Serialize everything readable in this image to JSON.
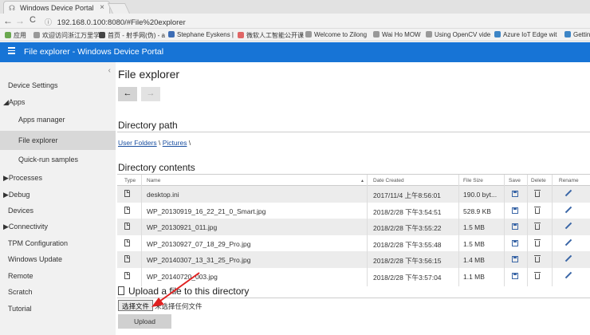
{
  "browser": {
    "tab_title": "Windows Device Portal",
    "tab_close": "×",
    "back": "←",
    "forward": "→",
    "reload": "C",
    "url": "192.168.0.100:8080/#File%20explorer",
    "bookmarks": [
      {
        "label": "应用",
        "color": "#6aa84f"
      },
      {
        "label": "欢迎访问浙江万里学",
        "color": "#999999"
      },
      {
        "label": "首页 - 射手网(伪) - a",
        "color": "#444444"
      },
      {
        "label": "Stephane Eyskens |",
        "color": "#3d6db5"
      },
      {
        "label": "微软人工智能公开课",
        "color": "#e06666"
      },
      {
        "label": "Welcome to Zilong",
        "color": "#999999"
      },
      {
        "label": "Wai Ho MOW",
        "color": "#999999"
      },
      {
        "label": "Using OpenCV vide",
        "color": "#999999"
      },
      {
        "label": "Azure IoT Edge wit",
        "color": "#3d85c6"
      },
      {
        "label": "Getting",
        "color": "#3d85c6"
      }
    ]
  },
  "header": {
    "title": "File explorer - Windows Device Portal"
  },
  "sidebar": {
    "collapse": "‹",
    "items": [
      {
        "label": "Device Settings"
      },
      {
        "label": "◢Apps"
      },
      {
        "label": "Apps manager"
      },
      {
        "label": "File explorer"
      },
      {
        "label": "Quick-run samples"
      },
      {
        "label": "▶Processes"
      },
      {
        "label": "▶Debug"
      },
      {
        "label": "Devices"
      },
      {
        "label": "▶Connectivity"
      },
      {
        "label": "TPM Configuration"
      },
      {
        "label": "Windows Update"
      },
      {
        "label": "Remote"
      },
      {
        "label": "Scratch"
      },
      {
        "label": "Tutorial"
      }
    ]
  },
  "main": {
    "title": "File explorer",
    "nav_back": "←",
    "nav_forward": "→",
    "path_heading": "Directory path",
    "crumbs": {
      "folder1": "User Folders",
      "sep1": " \\ ",
      "folder2": "Pictures",
      "sep2": " \\"
    },
    "contents_heading": "Directory contents",
    "columns": {
      "type": "Type",
      "name": "Name",
      "sort_marker": "▲",
      "date": "Date Created",
      "size": "File Size",
      "save": "Save",
      "delete": "Delete",
      "rename": "Rename"
    },
    "files": [
      {
        "name": "desktop.ini",
        "date": "2017/11/4 上午8:56:01",
        "size": "190.0 byt..."
      },
      {
        "name": "WP_20130919_16_22_21_0_Smart.jpg",
        "date": "2018/2/28 下午3:54:51",
        "size": "528.9 KB"
      },
      {
        "name": "WP_20130921_011.jpg",
        "date": "2018/2/28 下午3:55:22",
        "size": "1.5 MB"
      },
      {
        "name": "WP_20130927_07_18_29_Pro.jpg",
        "date": "2018/2/28 下午3:55:48",
        "size": "1.5 MB"
      },
      {
        "name": "WP_20140307_13_31_25_Pro.jpg",
        "date": "2018/2/28 下午3:56:15",
        "size": "1.4 MB"
      },
      {
        "name": "WP_20140720_003.jpg",
        "date": "2018/2/28 下午3:57:04",
        "size": "1.1 MB"
      }
    ],
    "upload_heading": "Upload a file to this directory",
    "choose_label": "选择文件",
    "no_file": "未选择任何文件",
    "upload_label": "Upload"
  },
  "colors": {
    "accent": "#1774d6",
    "annotation_arrow": "#e02020"
  }
}
